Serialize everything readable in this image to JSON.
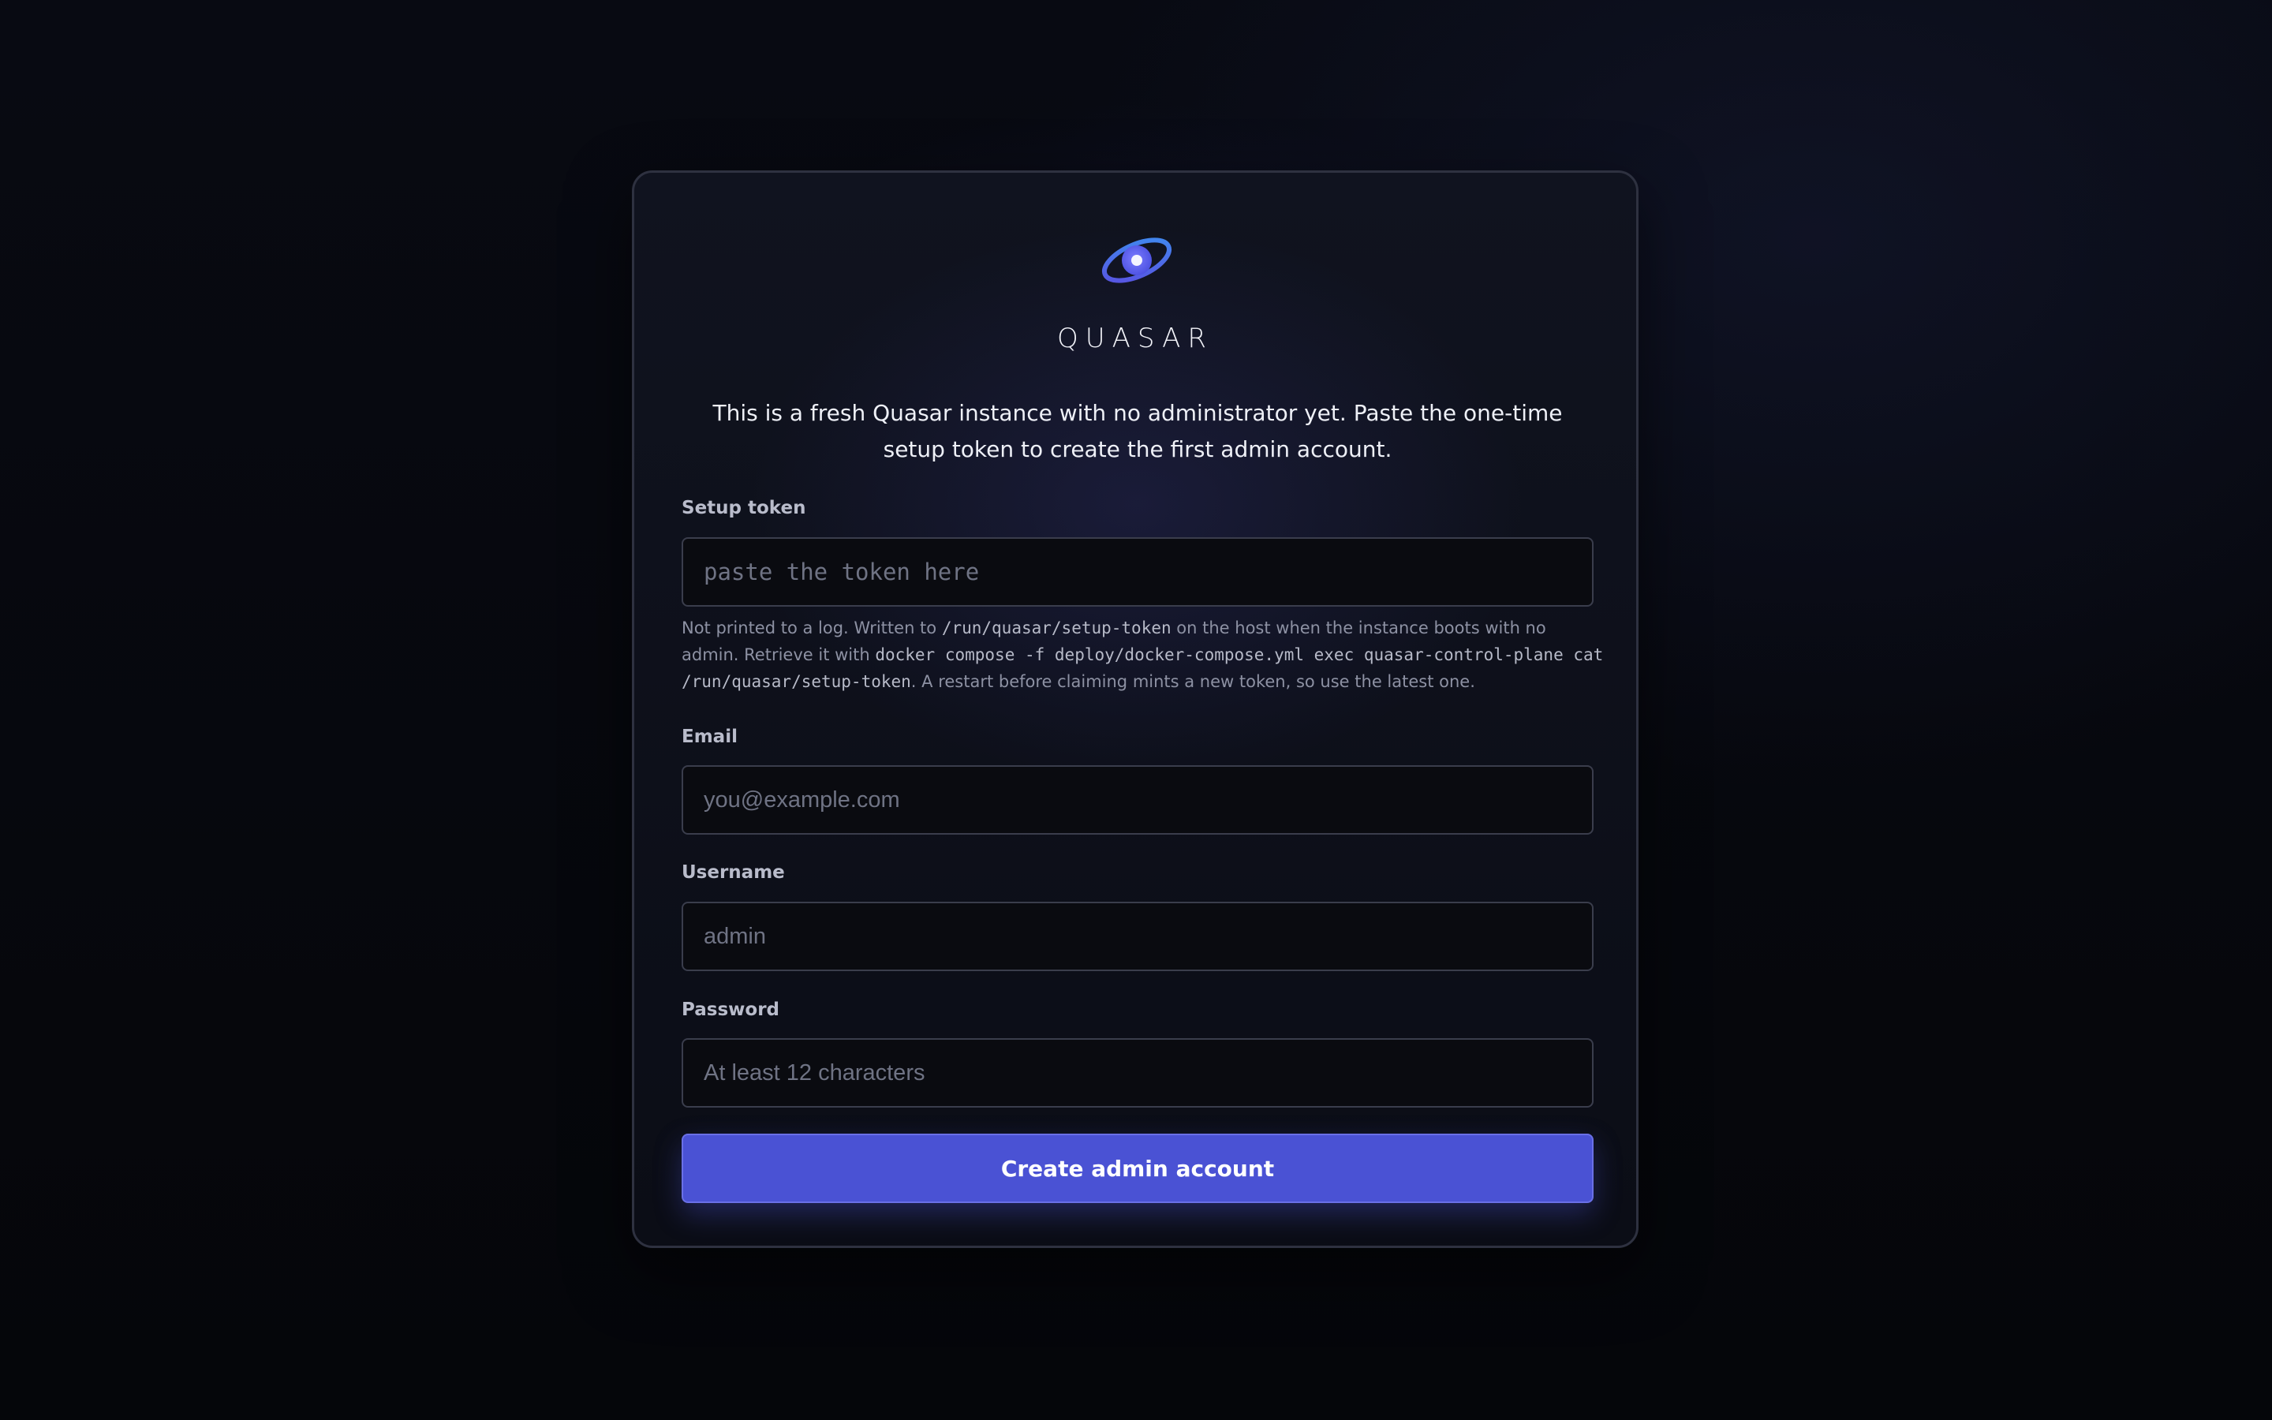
{
  "brand": {
    "name": "QUASAR",
    "logo_icon": "quasar-orbit-icon",
    "accent_color": "#4a52d4"
  },
  "intro": "This is a fresh Quasar instance with no administrator yet. Paste the one-time setup token to create the first admin account.",
  "form": {
    "setup_token": {
      "label": "Setup token",
      "placeholder": "paste the token here",
      "value": ""
    },
    "help": {
      "part1": "Not printed to a log. Written to ",
      "code1": "/run/quasar/setup-token",
      "part2": " on the host when the instance boots with no admin. Retrieve it with ",
      "code2": "docker compose -f deploy/docker-compose.yml exec quasar-control-plane cat /run/quasar/setup-token",
      "part3": ". A restart before claiming mints a new token, so use the latest one."
    },
    "email": {
      "label": "Email",
      "placeholder": "you@example.com",
      "value": ""
    },
    "username": {
      "label": "Username",
      "placeholder": "admin",
      "value": ""
    },
    "password": {
      "label": "Password",
      "placeholder": "At least 12 characters",
      "value": ""
    },
    "submit_label": "Create admin account"
  }
}
